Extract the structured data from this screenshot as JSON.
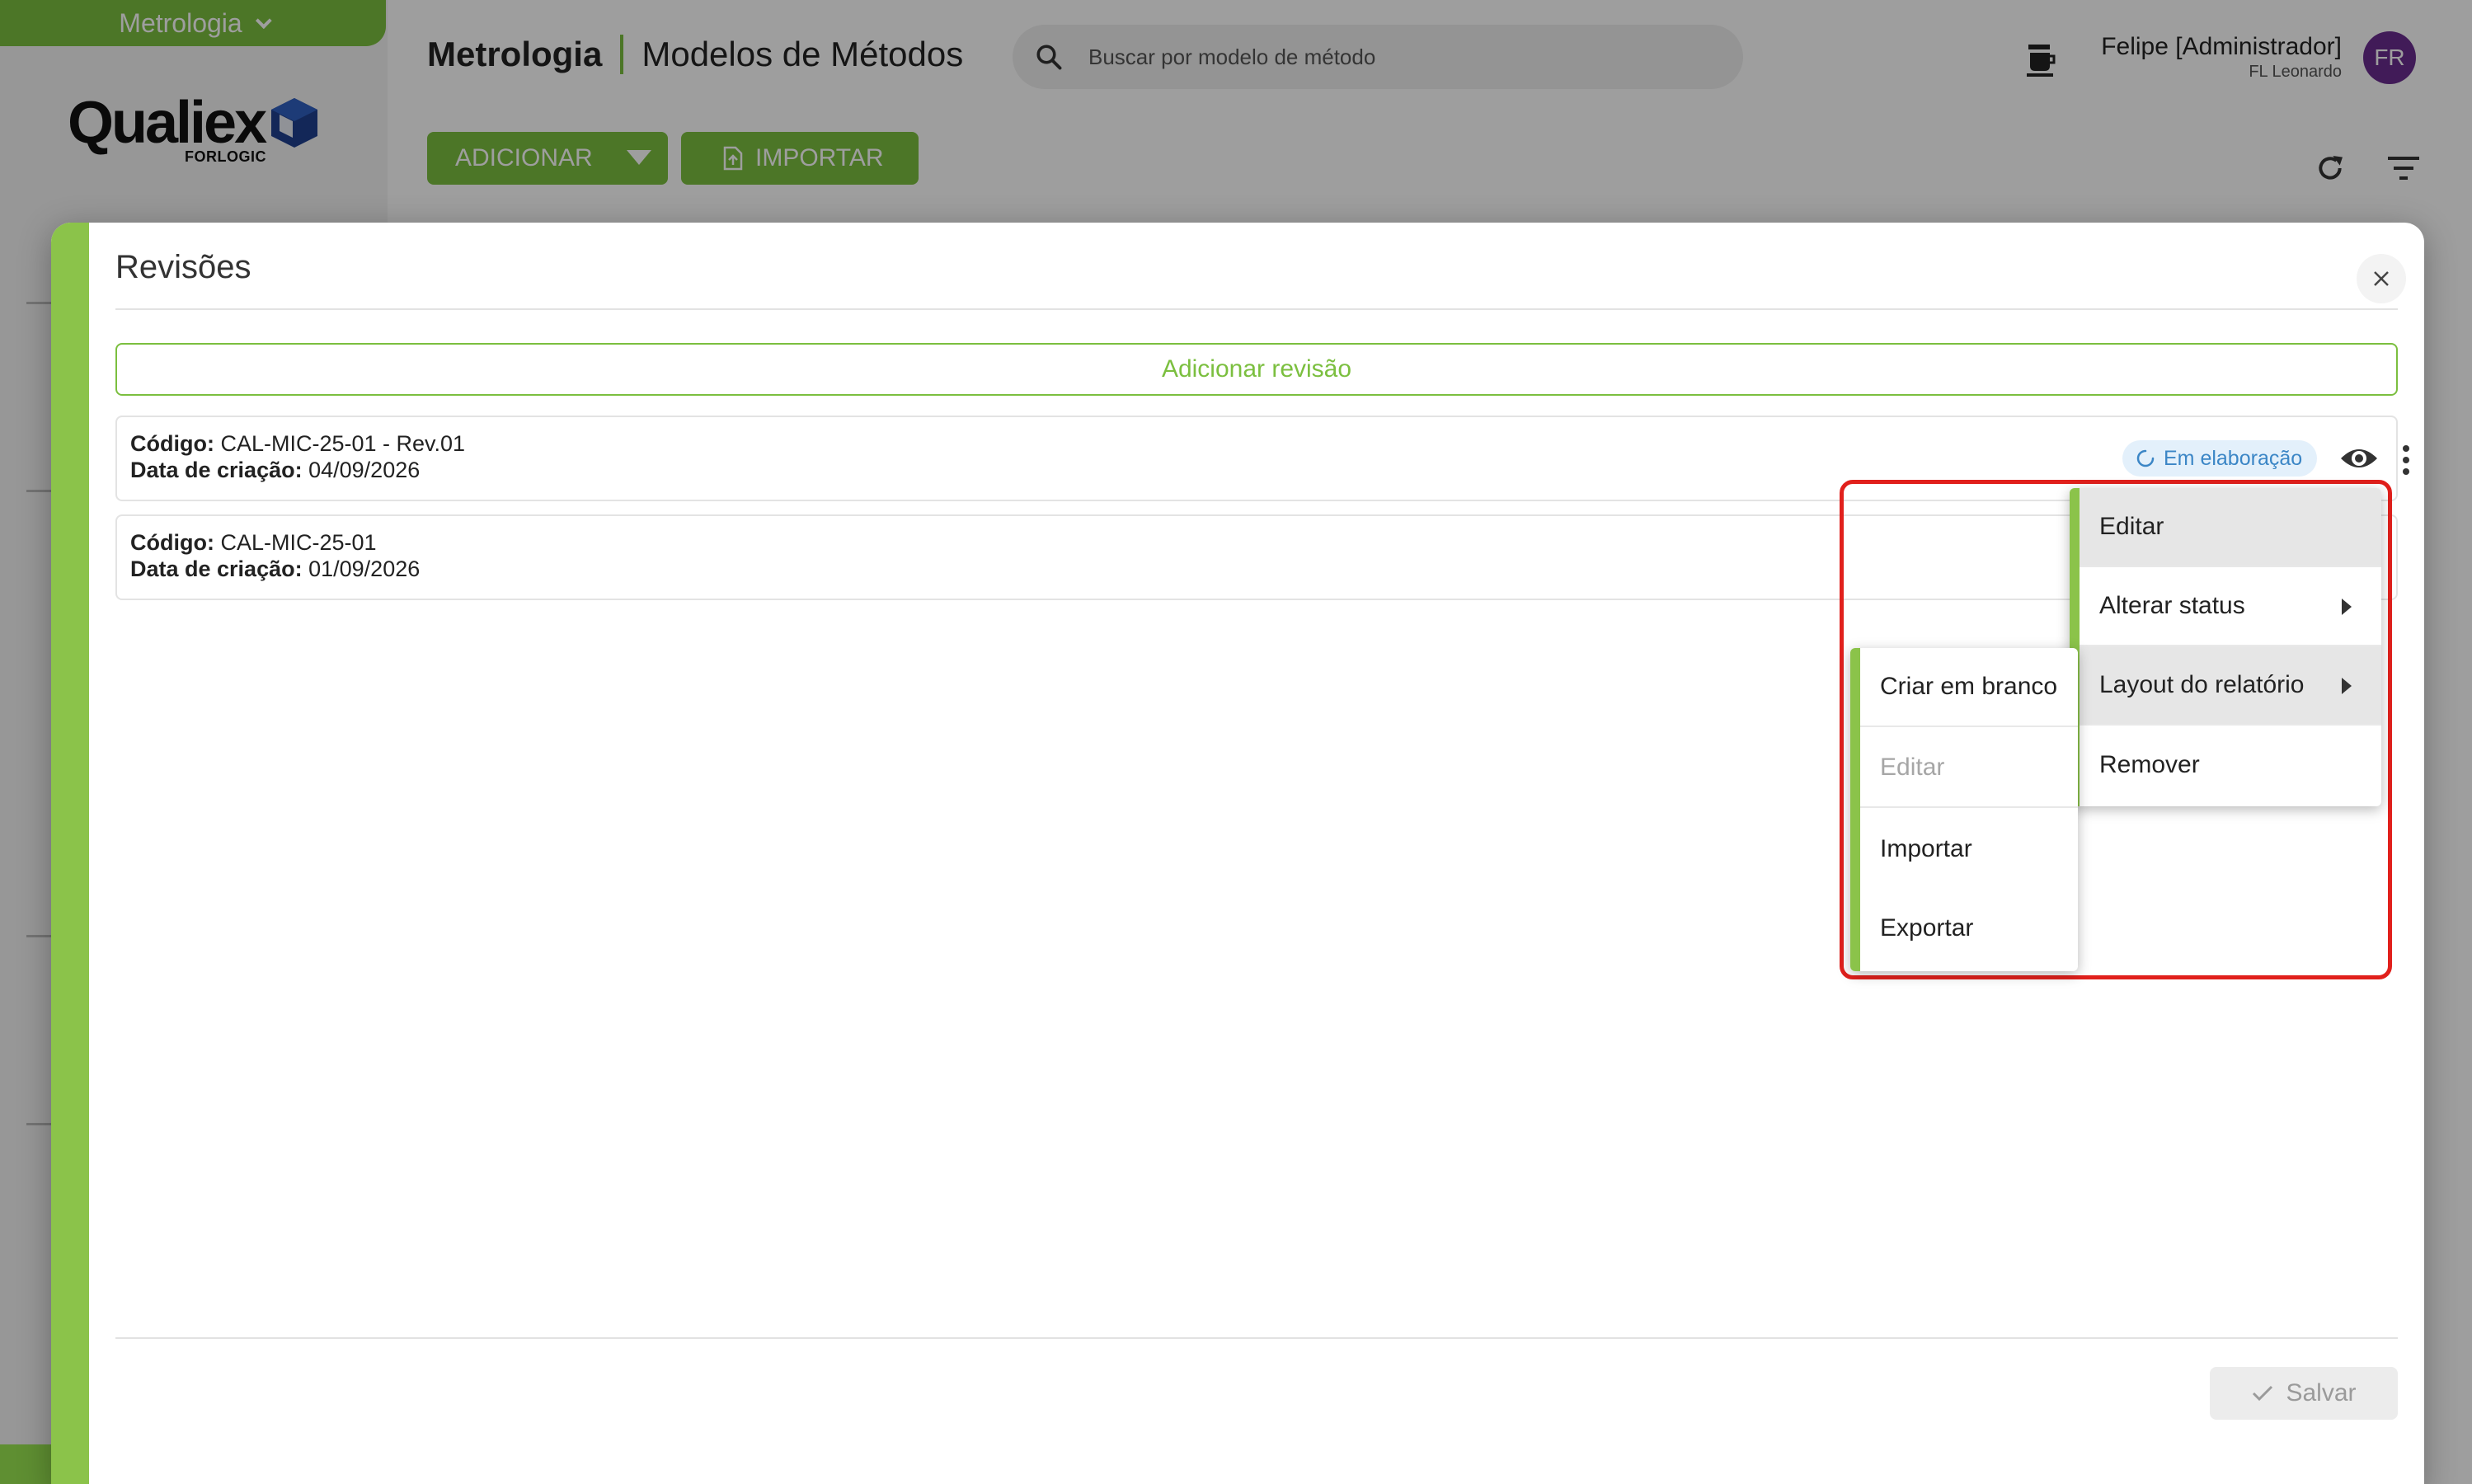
{
  "module": {
    "label": "Metrologia"
  },
  "logo": {
    "text": "Qualiex",
    "sub": "FORLOGIC"
  },
  "header": {
    "section": "Metrologia",
    "page": "Modelos de Métodos"
  },
  "search": {
    "placeholder": "Buscar por modelo de método"
  },
  "user": {
    "name": "Felipe [Administrador]",
    "org": "FL Leonardo",
    "initials": "FR"
  },
  "toolbar": {
    "add_label": "ADICIONAR",
    "import_label": "IMPORTAR"
  },
  "dialog": {
    "title": "Revisões",
    "add_revision": "Adicionar revisão",
    "save_label": "Salvar",
    "revisions": [
      {
        "code_label": "Código:",
        "code": "CAL-MIC-25-01 - Rev.01",
        "date_label": "Data de criação:",
        "date": "04/09/2026",
        "status": "Em elaboração"
      },
      {
        "code_label": "Código:",
        "code": "CAL-MIC-25-01",
        "date_label": "Data de criação:",
        "date": "01/09/2026"
      }
    ]
  },
  "context_menu": {
    "items": [
      "Editar",
      "Alterar status",
      "Layout do relatório",
      "Remover"
    ]
  },
  "submenu": {
    "items": [
      "Criar em branco",
      "Editar",
      "Importar",
      "Exportar"
    ]
  },
  "colors": {
    "accent": "#7bbf3f",
    "highlight_border": "#e1201c",
    "status_blue": "#3b86c6",
    "avatar": "#6a2d8f"
  },
  "icons": [
    "search-icon",
    "coffee-icon",
    "refresh-icon",
    "filter-icon",
    "close-icon",
    "eye-icon",
    "kebab-menu-icon",
    "loading-icon",
    "check-icon",
    "file-import-icon",
    "caret-down-icon",
    "chevron-right-icon"
  ]
}
